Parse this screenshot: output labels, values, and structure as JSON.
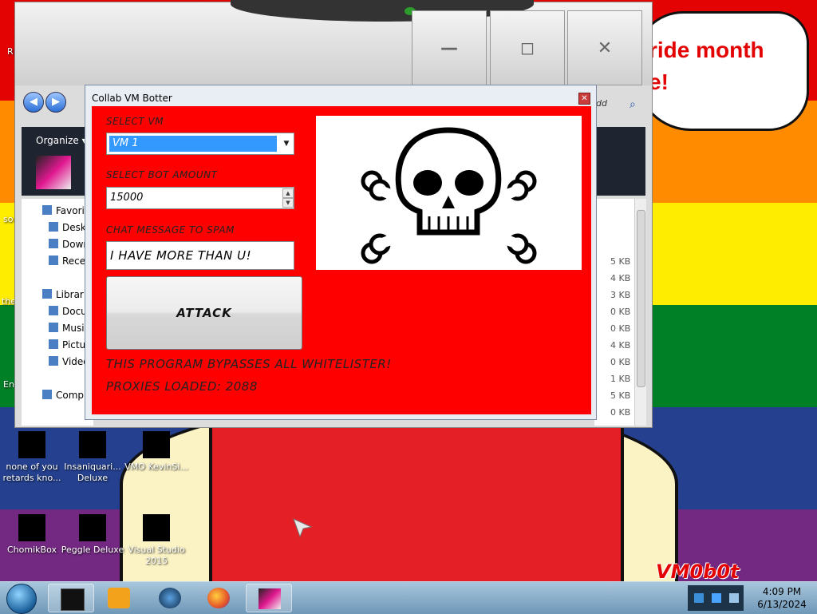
{
  "bubble": {
    "line1": "ride month",
    "line2": "e!"
  },
  "background_window": {
    "min_symbol": "—",
    "max_symbol": "◻",
    "close_symbol": "✕",
    "organize_label": "Organize ▾",
    "search_partial": "dd",
    "nav_items": [
      "Favorit",
      "Deskt",
      "Down",
      "Rece",
      "Librarie",
      "Docu",
      "Musi",
      "Pictu",
      "Video",
      "Compu"
    ],
    "sizes": [
      "5 KB",
      "4 KB",
      "3 KB",
      "0 KB",
      "0 KB",
      "4 KB",
      "0 KB",
      "1 KB",
      "5 KB",
      "0 KB"
    ]
  },
  "dialog": {
    "title": "Collab VM Botter",
    "close_symbol": "✕",
    "select_vm_label": "SELECT VM",
    "select_vm_value": "VM 1",
    "bot_amount_label": "SELECT BOT AMOUNT",
    "bot_amount_value": "15000",
    "chat_label": "CHAT MESSAGE TO SPAM",
    "chat_value": "I HAVE MORE THAN U!",
    "attack_label": "ATTACK",
    "bypass_text": "THIS PROGRAM BYPASSES ALL WHITELISTER!",
    "proxies_text": "PROXIES LOADED: 2088"
  },
  "desktop_icons": [
    {
      "label": "none of you retards kno..."
    },
    {
      "label": "Insaniquari... Deluxe"
    },
    {
      "label": "VMO KevinSi..."
    },
    {
      "label": "ChomikBox"
    },
    {
      "label": "Peggle Deluxe"
    },
    {
      "label": "Visual Studio 2015"
    }
  ],
  "edge_labels": [
    "R",
    "so",
    "the",
    "En"
  ],
  "watermark": "VM0b0t",
  "clock": {
    "time": "4:09 PM",
    "date": "6/13/2024"
  }
}
